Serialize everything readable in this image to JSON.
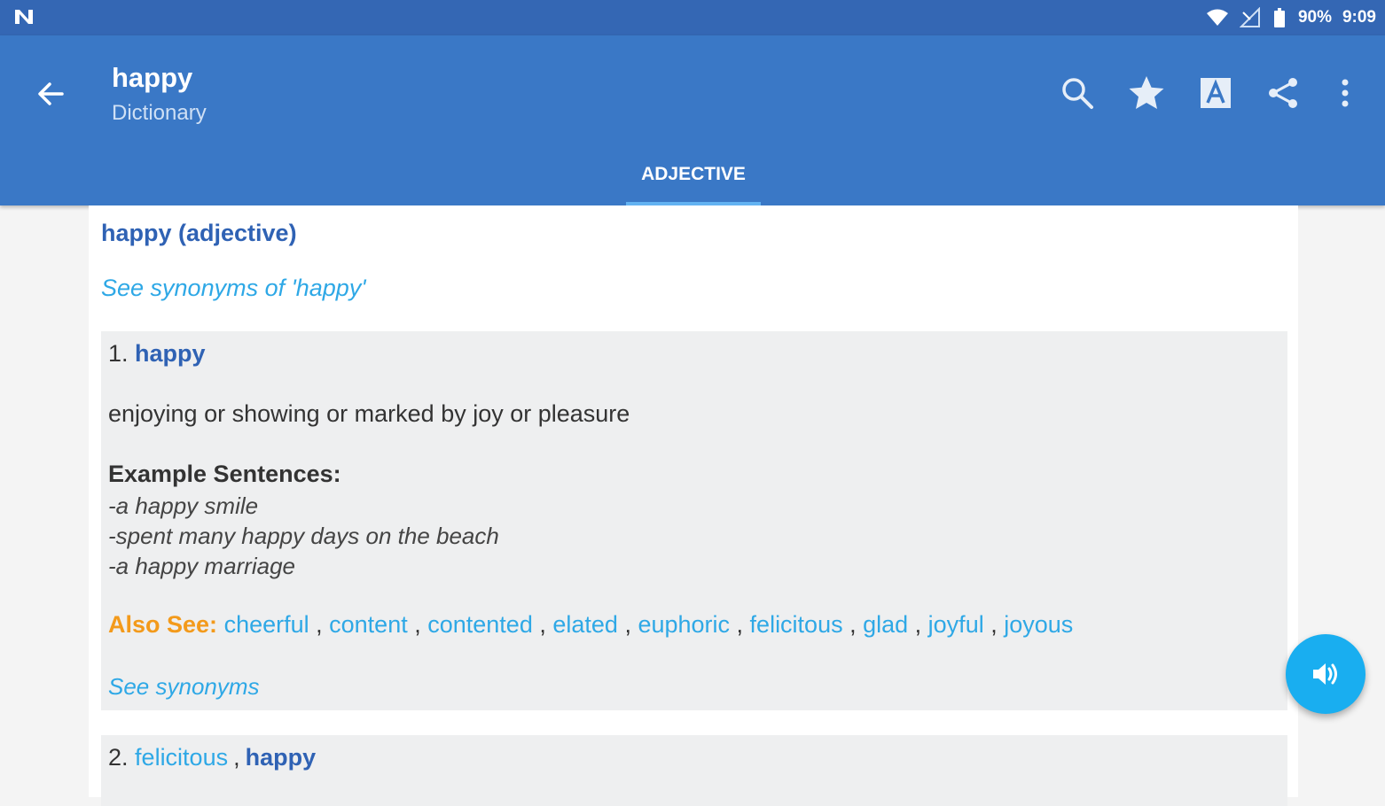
{
  "status_bar": {
    "notification_icon": "n-notification-icon",
    "battery": "90%",
    "time": "9:09"
  },
  "app_bar": {
    "title": "happy",
    "subtitle": "Dictionary",
    "actions": [
      "search-icon",
      "star-icon",
      "text-size-icon",
      "share-icon",
      "more-vert-icon"
    ]
  },
  "tabs": [
    {
      "label": "ADJECTIVE",
      "selected": true
    }
  ],
  "entry": {
    "heading": "happy (adjective)",
    "see_synonyms_top": "See synonyms of 'happy'"
  },
  "senses": [
    {
      "number": "1.",
      "words": [
        "happy"
      ],
      "definition": "enjoying or showing or marked by joy or pleasure",
      "examples_header": "Example Sentences:",
      "examples": [
        "-a happy smile",
        "-spent many happy days on the beach",
        "-a happy marriage"
      ],
      "also_see_label": "Also See:",
      "also_see": [
        "cheerful",
        "content",
        "contented",
        "elated",
        "euphoric",
        "felicitous",
        "glad",
        "joyful",
        "joyous"
      ],
      "see_synonyms": "See synonyms"
    },
    {
      "number": "2.",
      "words": [
        "felicitous",
        "happy"
      ],
      "separator": ","
    }
  ],
  "fab": {
    "icon": "speaker-icon"
  },
  "colors": {
    "status_bar": "#3467b4",
    "app_bar": "#3a78c6",
    "link": "#2ea8e6",
    "heading": "#2f62b4",
    "also_see": "#f39a1b",
    "fab": "#19aef0"
  }
}
